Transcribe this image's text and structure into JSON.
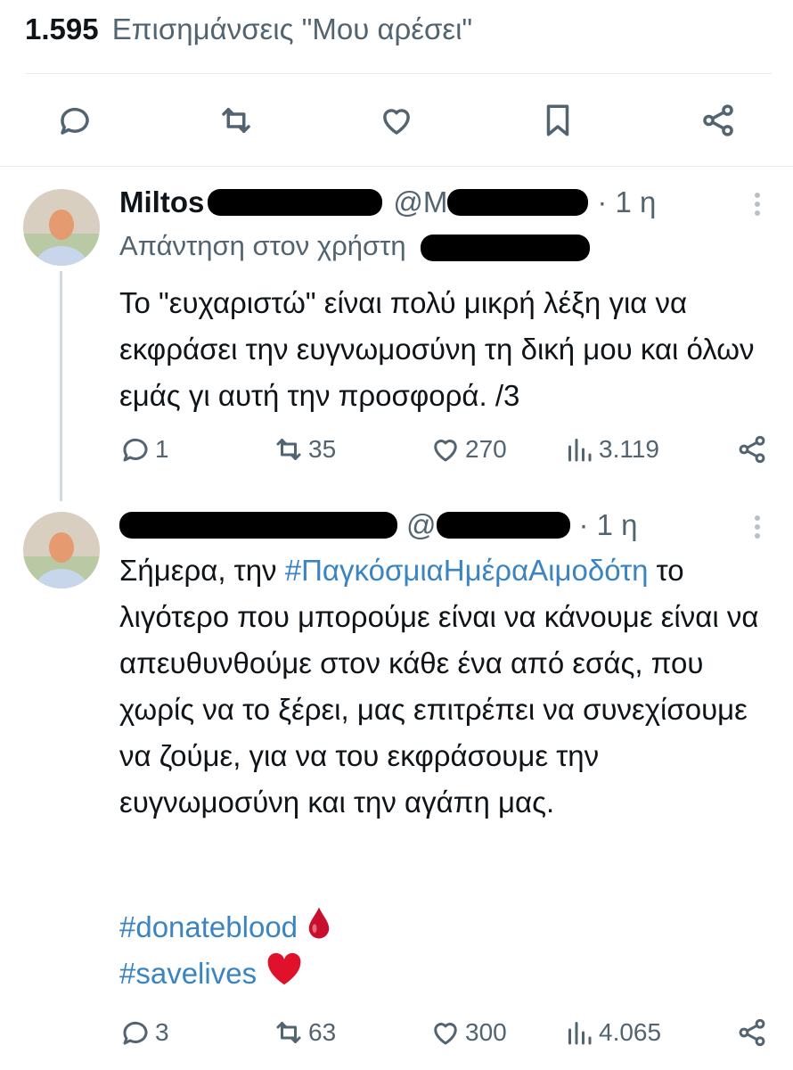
{
  "likes_summary": {
    "count": "1.595",
    "label": "Επισημάνσεις \"Μου αρέσει\""
  },
  "action_bar": {
    "icons": [
      "reply-icon",
      "retweet-icon",
      "like-icon",
      "bookmark-icon",
      "share-icon"
    ]
  },
  "tweets": [
    {
      "display_name": "Miltos",
      "handle_prefix": "@M",
      "time": "· 1 η",
      "reply_to_label": "Απάντηση στον χρήστη",
      "text": "Το \"ευχαριστώ\" είναι πολύ μικρή λέξη για να εκφράσει την ευγνωμοσύνη τη δική μου και όλων εμάς γι αυτή την προσφορά. /3",
      "stats": {
        "replies": "1",
        "retweets": "35",
        "likes": "270",
        "views": "3.119"
      }
    },
    {
      "handle_prefix": "@",
      "time": "· 1 η",
      "text_intro": "Σήμερα, την",
      "hashtag_main": "#ΠαγκόσμιαΗμέραΑιμοδότη",
      "text_body": "το λιγότερο που μπορούμε είναι να κάνουμε είναι να απευθυνθούμε στον κάθε ένα από εσάς, που χωρίς να το ξέρει, μας επιτρέπει να συνεχίσουμε να ζούμε, για να του εκφράσουμε την ευγνωμοσύνη και την αγάπη μας.",
      "hashtag_1": "#donateblood",
      "hashtag_2": "#savelives",
      "stats": {
        "replies": "3",
        "retweets": "63",
        "likes": "300",
        "views": "4.065"
      }
    }
  ],
  "colors": {
    "text": "#0f1419",
    "secondary": "#536471",
    "hashtag": "#3a84c2",
    "divider": "#e7e9eb"
  }
}
